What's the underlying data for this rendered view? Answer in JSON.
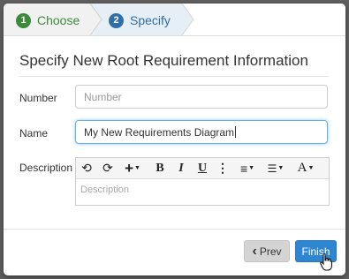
{
  "wizard": {
    "steps": [
      {
        "number": "1",
        "label": "Choose"
      },
      {
        "number": "2",
        "label": "Specify"
      }
    ]
  },
  "dialog": {
    "title": "Specify New Root Requirement Information"
  },
  "form": {
    "number_label": "Number",
    "number_placeholder": "Number",
    "name_label": "Name",
    "name_value": "My New Requirements Diagram",
    "description_label": "Description",
    "description_placeholder": "Description"
  },
  "toolbar": {
    "undo": "⟲",
    "redo": "⟳",
    "insert": "+",
    "bold": "B",
    "italic": "I",
    "underline": "U",
    "more": "⋮",
    "align": "≡",
    "list": "☰",
    "font": "A",
    "caret": "▼"
  },
  "buttons": {
    "prev_label": "Prev",
    "prev_icon": "‹",
    "finish_label": "Finish"
  },
  "colors": {
    "step1": "#3b8a3b",
    "step2": "#2f6ea6",
    "finish": "#2f86d0",
    "focus": "#66afe9"
  }
}
